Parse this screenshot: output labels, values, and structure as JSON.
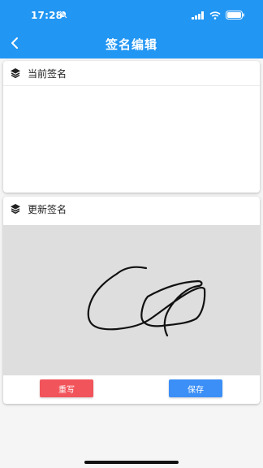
{
  "status_bar": {
    "time": "17:28",
    "icons": [
      "bell-slash-icon",
      "signal-icon",
      "wifi-icon",
      "battery-icon"
    ]
  },
  "header": {
    "title": "签名编辑",
    "back_icon": "chevron-left-icon",
    "background_color": "#2296f3"
  },
  "current_signature": {
    "title": "当前签名",
    "icon": "layers-icon"
  },
  "update_signature": {
    "title": "更新签名",
    "icon": "layers-icon",
    "pad_color": "#dedede"
  },
  "actions": {
    "reset_label": "重写",
    "save_label": "保存",
    "reset_color": "#f2545b",
    "save_color": "#3b8ff6"
  }
}
